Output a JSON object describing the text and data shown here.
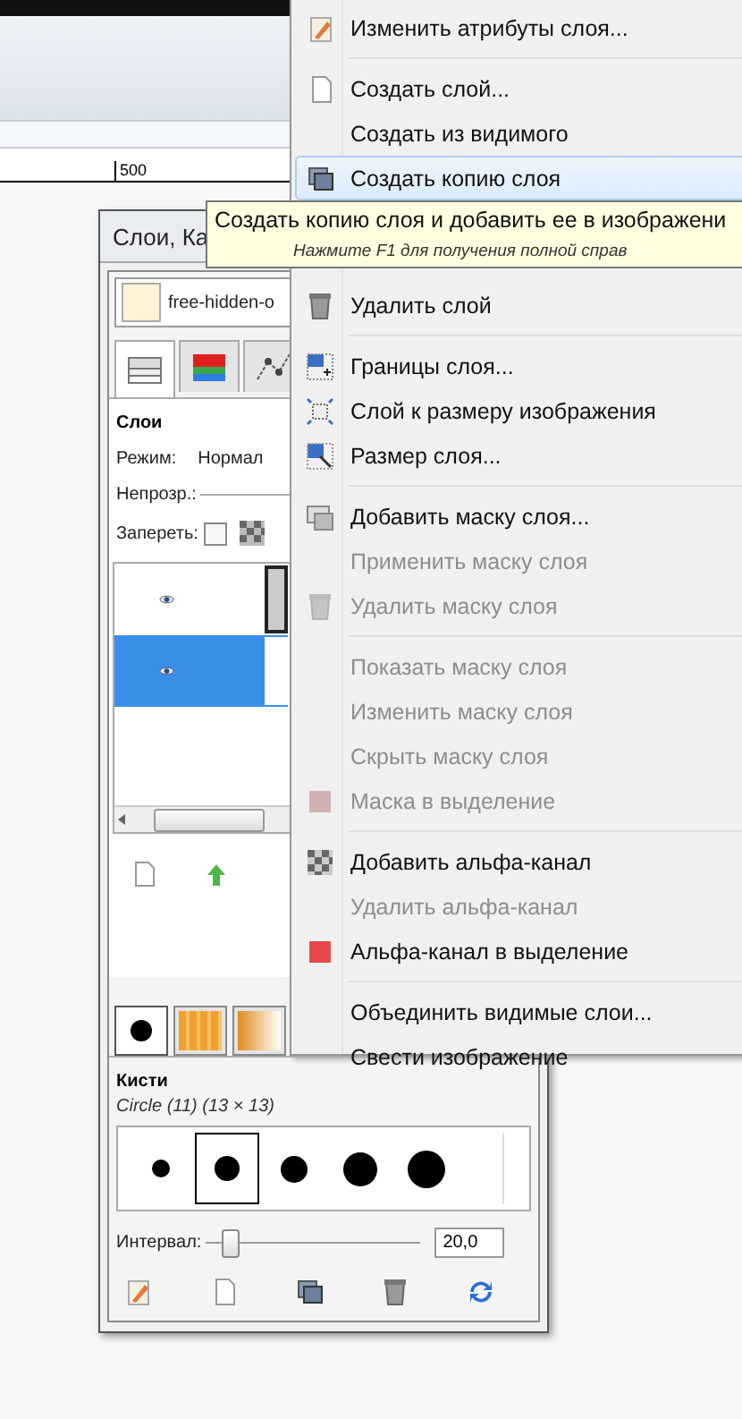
{
  "background": {
    "ruler_label": "500"
  },
  "dock": {
    "title": "Слои, Ка",
    "image": "free-hidden-o",
    "tabs": [
      {
        "selected": true
      },
      {
        "selected": false
      },
      {
        "selected": false
      }
    ],
    "panel_title": "Слои",
    "mode_label": "Режим:",
    "mode_value": "Нормал",
    "opacity_label": "Непрозр.:",
    "lock_label": "Запереть:",
    "lock_checked": false,
    "layers": [
      {
        "visible": true,
        "selected": false
      },
      {
        "visible": true,
        "selected": true
      }
    ],
    "brush_tabs": [
      {
        "selected": true
      },
      {
        "selected": false
      },
      {
        "selected": false
      }
    ],
    "brushes_title": "Кисти",
    "brush_name": "Circle (11) (13 × 13)",
    "brushes": [
      {
        "selected": false
      },
      {
        "selected": true
      },
      {
        "selected": false
      },
      {
        "selected": false
      },
      {
        "selected": false
      }
    ],
    "spacing_label": "Интервал:",
    "spacing": {
      "level": 0.08
    },
    "spacing_value": "20,0"
  },
  "menu": {
    "groups": [
      [
        {
          "label": "Изменить атрибуты слоя...",
          "disabled": false,
          "selected": false
        }
      ],
      [
        {
          "label": "Создать слой...",
          "disabled": false,
          "selected": false
        },
        {
          "label": "Создать из видимого",
          "disabled": false,
          "selected": false
        },
        {
          "label": "Создать копию слоя",
          "disabled": false,
          "selected": true
        },
        {
          "label": "Удалить слой",
          "disabled": false,
          "selected": false
        }
      ],
      [
        {
          "label": "Границы слоя...",
          "disabled": false,
          "selected": false
        },
        {
          "label": "Слой к размеру изображения",
          "disabled": false,
          "selected": false
        },
        {
          "label": "Размер слоя...",
          "disabled": false,
          "selected": false
        }
      ],
      [
        {
          "label": "Добавить маску слоя...",
          "disabled": false,
          "selected": false
        },
        {
          "label": "Применить маску слоя",
          "disabled": true,
          "selected": false
        },
        {
          "label": "Удалить маску слоя",
          "disabled": true,
          "selected": false
        }
      ],
      [
        {
          "label": "Показать маску слоя",
          "disabled": true,
          "selected": false
        },
        {
          "label": "Изменить маску слоя",
          "disabled": true,
          "selected": false
        },
        {
          "label": "Скрыть маску слоя",
          "disabled": true,
          "selected": false
        },
        {
          "label": "Маска в выделение",
          "disabled": true,
          "selected": false
        }
      ],
      [
        {
          "label": "Добавить альфа-канал",
          "disabled": false,
          "selected": false
        },
        {
          "label": "Удалить альфа-канал",
          "disabled": true,
          "selected": false
        },
        {
          "label": "Альфа-канал в выделение",
          "disabled": false,
          "selected": false
        }
      ],
      [
        {
          "label": "Объединить видимые слои...",
          "disabled": false,
          "selected": false
        },
        {
          "label": "Свести изображение",
          "disabled": false,
          "selected": false
        }
      ]
    ]
  },
  "tooltip": {
    "text": "Создать копию слоя и добавить ее в изображени",
    "hint": "Нажмите F1 для получения полной справ"
  }
}
